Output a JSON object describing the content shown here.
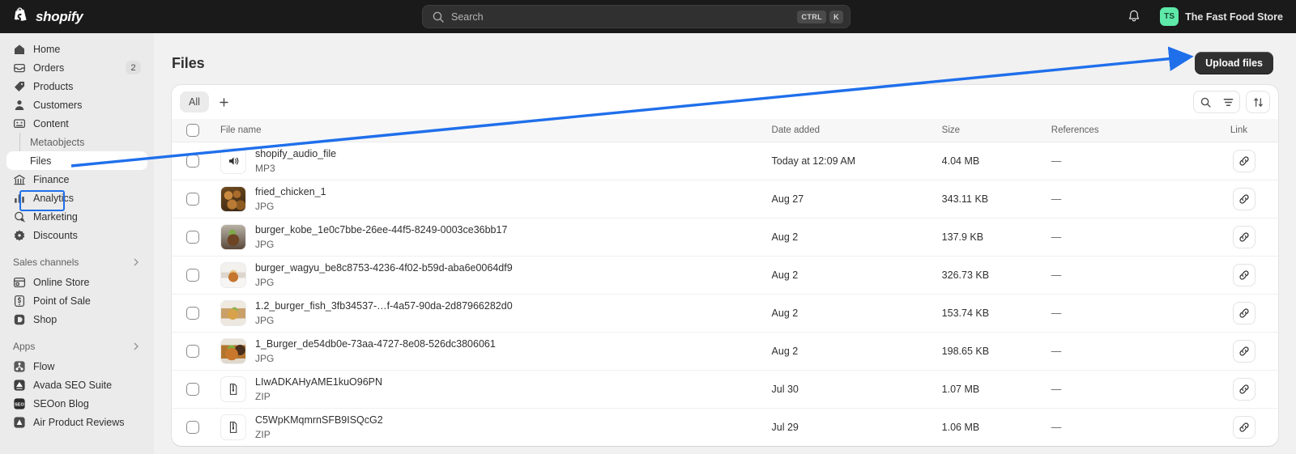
{
  "topbar": {
    "brand": "shopify",
    "brand_icon": "shopify-bag-icon",
    "search": {
      "placeholder": "Search",
      "icon": "search-icon",
      "kbd_ctrl": "CTRL",
      "kbd_key": "K"
    },
    "notifications_icon": "bell-icon",
    "store": {
      "initials": "TS",
      "name": "The Fast Food Store"
    }
  },
  "sidebar": {
    "items": [
      {
        "label": "Home",
        "icon": "home-icon",
        "badge": ""
      },
      {
        "label": "Orders",
        "icon": "orders-box-icon",
        "badge": "2"
      },
      {
        "label": "Products",
        "icon": "products-tag-icon",
        "badge": ""
      },
      {
        "label": "Customers",
        "icon": "customers-person-icon",
        "badge": ""
      },
      {
        "label": "Content",
        "icon": "content-media-icon",
        "badge": ""
      }
    ],
    "content_children": [
      {
        "label": "Metaobjects",
        "active": false
      },
      {
        "label": "Files",
        "active": true
      }
    ],
    "items_after": [
      {
        "label": "Finance",
        "icon": "finance-bank-icon",
        "badge": ""
      },
      {
        "label": "Analytics",
        "icon": "analytics-bars-icon",
        "badge": ""
      },
      {
        "label": "Marketing",
        "icon": "marketing-megaphone-icon",
        "badge": ""
      },
      {
        "label": "Discounts",
        "icon": "discounts-badge-icon",
        "badge": ""
      }
    ],
    "sales_channels": {
      "title": "Sales channels",
      "chevron_icon": "chevron-right-icon",
      "items": [
        {
          "label": "Online Store",
          "icon": "online-store-icon"
        },
        {
          "label": "Point of Sale",
          "icon": "point-of-sale-icon"
        },
        {
          "label": "Shop",
          "icon": "shop-icon"
        }
      ]
    },
    "apps": {
      "title": "Apps",
      "chevron_icon": "chevron-right-icon",
      "items": [
        {
          "label": "Flow",
          "icon": "flow-app-icon"
        },
        {
          "label": "Avada SEO Suite",
          "icon": "avada-app-icon"
        },
        {
          "label": "SEOon Blog",
          "icon": "seoon-app-icon"
        },
        {
          "label": "Air Product Reviews",
          "icon": "air-reviews-app-icon"
        }
      ]
    }
  },
  "page": {
    "title": "Files",
    "upload_button": "Upload files"
  },
  "toolbar": {
    "tabs": [
      {
        "label": "All",
        "selected": true
      }
    ],
    "add_tab_icon": "plus-icon",
    "search_icon": "search-icon",
    "filter_icon": "filter-icon",
    "sort_icon": "sort-arrows-icon"
  },
  "table": {
    "columns": [
      "",
      "File name",
      "Date added",
      "Size",
      "References",
      "Link"
    ],
    "select_all_icon": "checkbox-icon",
    "link_icon": "link-chain-icon",
    "rows": [
      {
        "name": "shopify_audio_file",
        "type": "MP3",
        "date": "Today at 12:09 AM",
        "size": "4.04 MB",
        "references": "—",
        "thumb": "audio-speaker-icon"
      },
      {
        "name": "fried_chicken_1",
        "type": "JPG",
        "date": "Aug 27",
        "size": "343.11 KB",
        "references": "—",
        "thumb": "ph-chicken"
      },
      {
        "name": "burger_kobe_1e0c7bbe-26ee-44f5-8249-0003ce36bb17",
        "type": "JPG",
        "date": "Aug 2",
        "size": "137.9 KB",
        "references": "—",
        "thumb": "ph-kobe"
      },
      {
        "name": "burger_wagyu_be8c8753-4236-4f02-b59d-aba6e0064df9",
        "type": "JPG",
        "date": "Aug 2",
        "size": "326.73 KB",
        "references": "—",
        "thumb": "ph-wagyu"
      },
      {
        "name": "1.2_burger_fish_3fb34537-…f-4a57-90da-2d87966282d0",
        "type": "JPG",
        "date": "Aug 2",
        "size": "153.74 KB",
        "references": "—",
        "thumb": "ph-fish"
      },
      {
        "name": "1_Burger_de54db0e-73aa-4727-8e08-526dc3806061",
        "type": "JPG",
        "date": "Aug 2",
        "size": "198.65 KB",
        "references": "—",
        "thumb": "ph-burger1"
      },
      {
        "name": "LIwADKAHyAME1kuO96PN",
        "type": "ZIP",
        "date": "Jul 30",
        "size": "1.07 MB",
        "references": "—",
        "thumb": "zip-file-icon"
      },
      {
        "name": "C5WpKMqmrnSFB9ISQcG2",
        "type": "ZIP",
        "date": "Jul 29",
        "size": "1.06 MB",
        "references": "—",
        "thumb": "zip-file-icon"
      }
    ]
  },
  "annotation": {
    "highlight_target": "Files",
    "arrow_target": "Upload files",
    "color": "#1f6feb"
  }
}
